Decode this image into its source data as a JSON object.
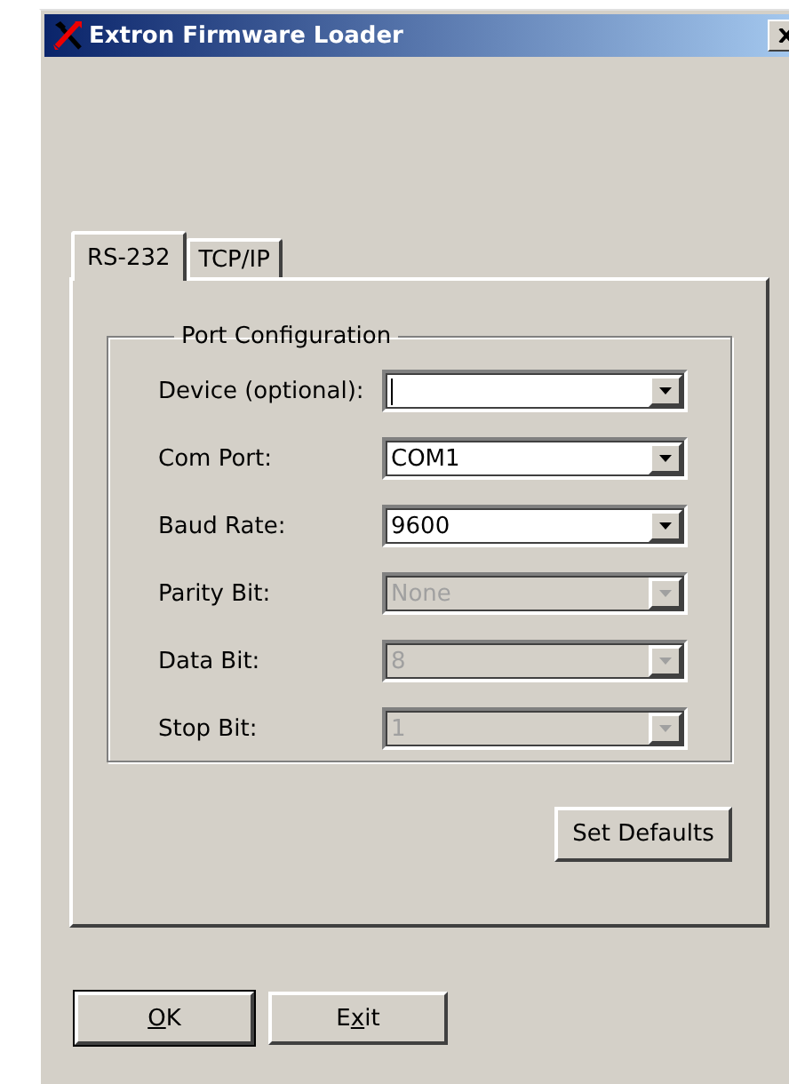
{
  "window": {
    "title": "Extron Firmware Loader"
  },
  "tabs": [
    {
      "label": "RS-232",
      "selected": true
    },
    {
      "label": "TCP/IP",
      "selected": false
    }
  ],
  "port_configuration": {
    "title": "Port Configuration",
    "fields": [
      {
        "label": "Device (optional):",
        "disabled": false,
        "focused": true
      },
      {
        "label": "Com Port:",
        "value": "COM1",
        "disabled": false,
        "focused": false
      },
      {
        "label": "Baud Rate:",
        "value": "9600",
        "disabled": false,
        "focused": false
      },
      {
        "label": "Parity Bit:",
        "value": "None",
        "disabled": true,
        "focused": false
      },
      {
        "label": "Data Bit:",
        "value": "8",
        "disabled": true,
        "focused": false
      },
      {
        "label": "Stop Bit:",
        "value": "1",
        "disabled": true,
        "focused": false
      }
    ]
  },
  "set_defaults_button": {
    "label": "Set Defaults"
  },
  "buttons": [
    {
      "label": [
        {
          "text": "O",
          "underlined": true
        },
        {
          "text": "K",
          "underlined": false
        }
      ],
      "default": true
    },
    {
      "label": [
        {
          "text": "E",
          "underlined": false
        },
        {
          "text": "x",
          "underlined": true
        },
        {
          "text": "it",
          "underlined": false
        }
      ],
      "default": false
    }
  ]
}
